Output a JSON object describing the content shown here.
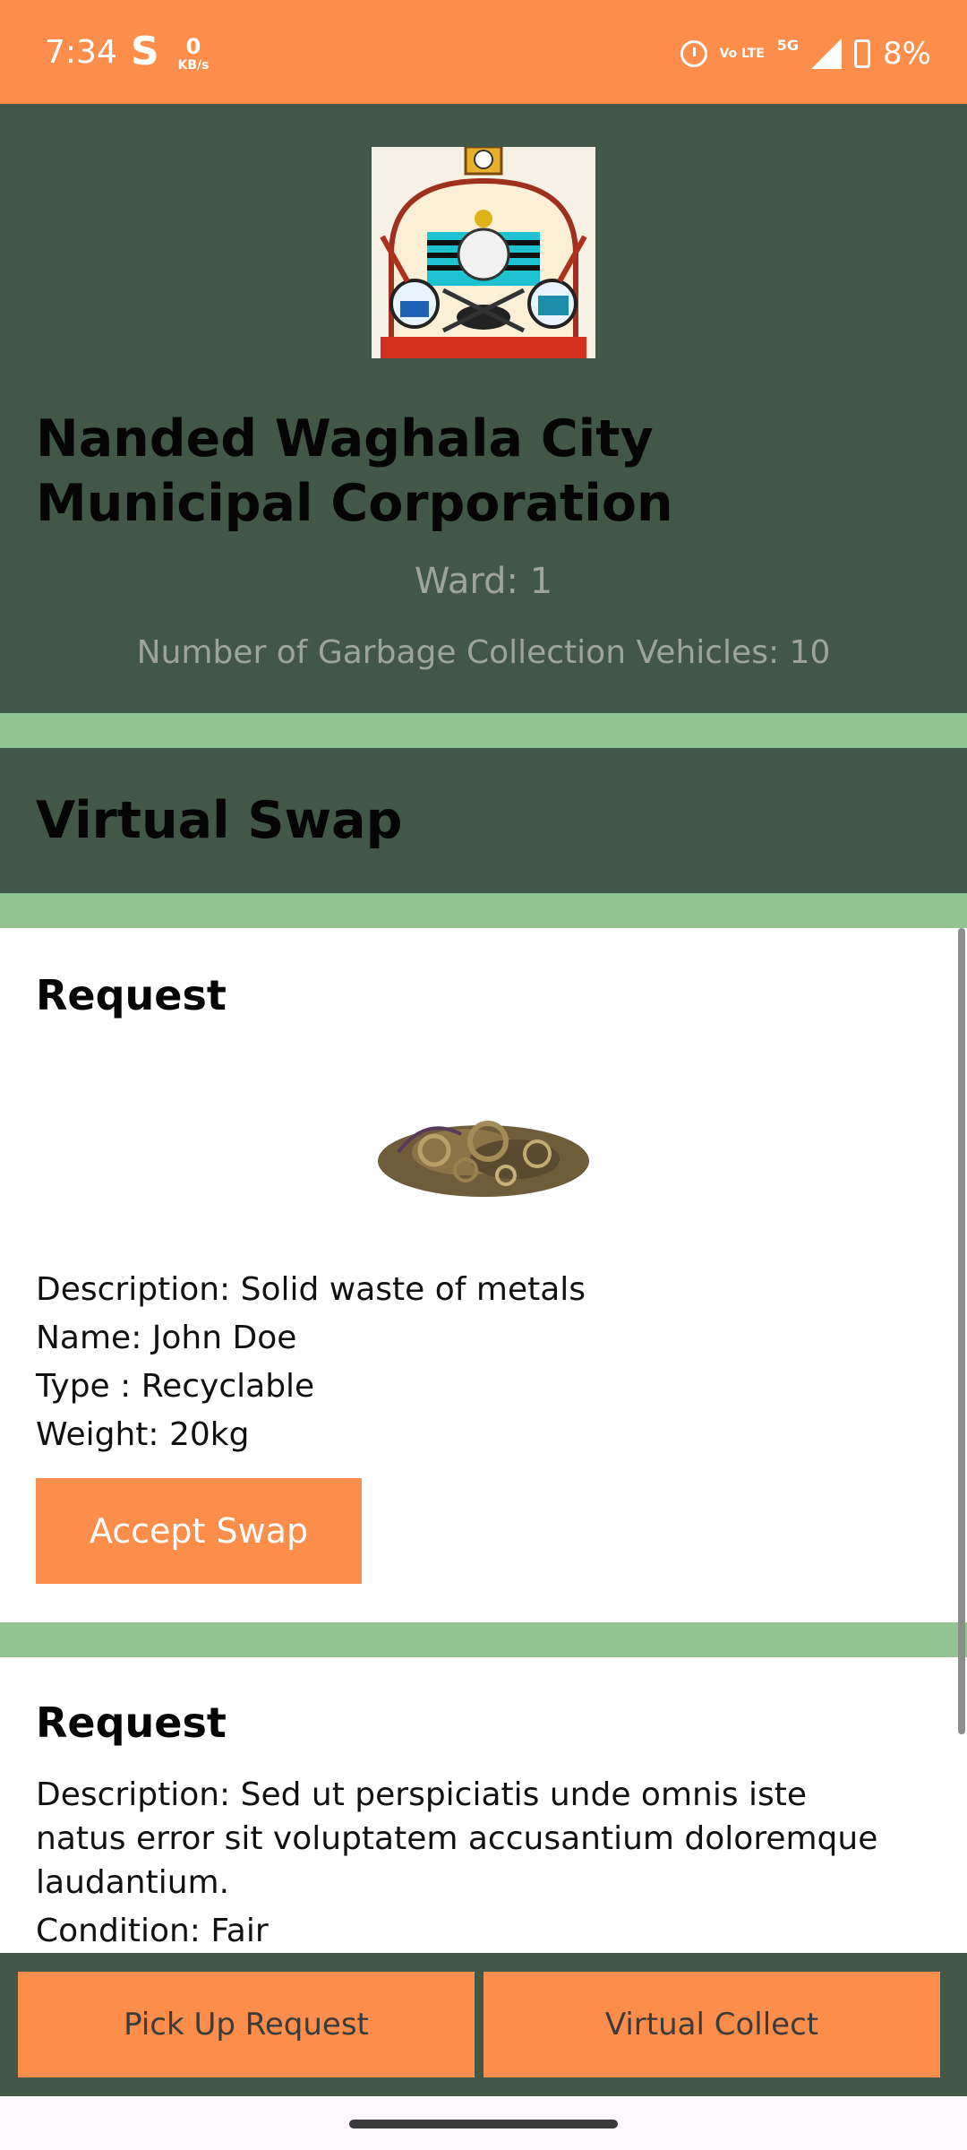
{
  "status_bar": {
    "time": "7:34",
    "app_icon": "S",
    "net_speed_value": "0",
    "net_speed_unit": "KB/s",
    "volte": "Vo LTE",
    "network": "5G",
    "battery": "8%",
    "icons": [
      "alarm-icon",
      "signal-icon",
      "battery-charging-icon"
    ]
  },
  "header": {
    "logo_icon": "municipal-corporation-emblem",
    "title": "Nanded Waghala City Municipal Corporation",
    "ward": "Ward: 1",
    "vehicles": "Number of Garbage Collection Vehicles: 10"
  },
  "section": {
    "title": "Virtual Swap"
  },
  "requests": [
    {
      "title": "Request",
      "image_icon": "scrap-metal-image",
      "description": "Description: Solid waste of metals",
      "name": "Name: John Doe",
      "type": "Type : Recyclable",
      "weight": "Weight: 20kg",
      "button": "Accept Swap"
    },
    {
      "title": "Request",
      "description_line1": "Description: Sed ut perspiciatis unde omnis iste",
      "description_line2": "natus error sit voluptatem accusantium doloremque",
      "description_line3": "laudantium.",
      "condition": "Condition: Fair"
    }
  ],
  "bottom_nav": {
    "pickup": "Pick Up Request",
    "collect": "Virtual Collect"
  },
  "colors": {
    "accent_orange": "#fc8d4a",
    "dark_green": "#415747",
    "light_green": "#93c593"
  }
}
